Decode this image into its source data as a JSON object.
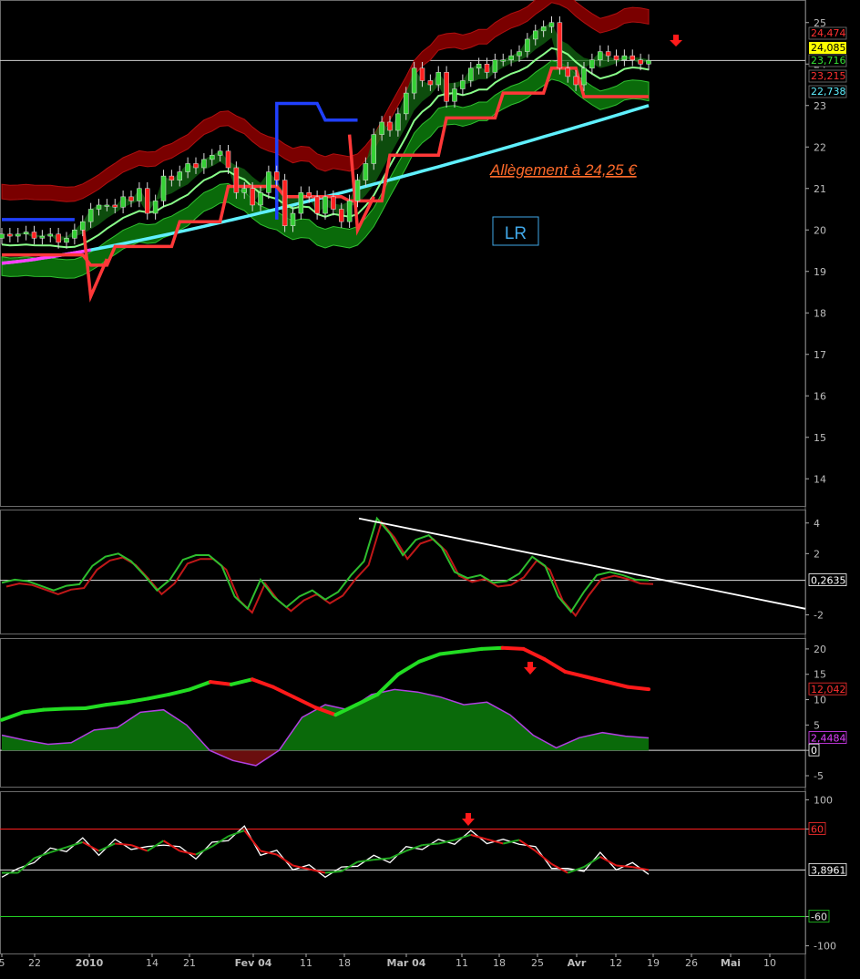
{
  "chart_data": [
    {
      "type": "candlestick",
      "panel": "price",
      "ylim": [
        13.5,
        25.5
      ],
      "y_ticks": [
        "25",
        "24",
        "23",
        "22",
        "21",
        "20",
        "19",
        "18",
        "17",
        "16",
        "15",
        "14"
      ],
      "price_labels": [
        {
          "text": "24,474",
          "color": "#ff3030"
        },
        {
          "text": "24,085",
          "color": "#000000",
          "bg": "#ffff00"
        },
        {
          "text": "23,716",
          "color": "#35e035"
        },
        {
          "text": "23,215",
          "color": "#ff3030"
        },
        {
          "text": "22,738",
          "color": "#5ff0ff"
        }
      ],
      "last_price": 24.085,
      "annotation": "Allègement à 24,25 €",
      "badge": "LR",
      "series": {
        "closes": [
          19.9,
          19.85,
          19.9,
          19.95,
          19.8,
          19.85,
          19.9,
          19.7,
          19.8,
          20.0,
          20.2,
          20.5,
          20.6,
          20.6,
          20.55,
          20.8,
          20.7,
          21.0,
          20.4,
          20.7,
          21.3,
          21.2,
          21.4,
          21.6,
          21.5,
          21.7,
          21.8,
          21.9,
          21.5,
          20.9,
          21.0,
          20.6,
          20.9,
          21.4,
          21.2,
          20.1,
          20.4,
          20.9,
          20.8,
          20.4,
          20.8,
          20.5,
          20.2,
          20.7,
          21.2,
          21.6,
          22.3,
          22.6,
          22.4,
          22.8,
          23.3,
          23.9,
          23.6,
          23.5,
          23.8,
          23.1,
          23.4,
          23.6,
          23.9,
          24.0,
          23.8,
          24.1,
          24.1,
          24.2,
          24.3,
          24.6,
          24.8,
          24.9,
          25.0,
          23.9,
          23.7,
          23.5,
          23.9,
          24.1,
          24.3,
          24.2,
          24.1,
          24.2,
          24.1,
          24.0,
          24.085
        ]
      }
    },
    {
      "type": "line",
      "panel": "oscillator-1",
      "ylim": [
        -3.1,
        4.7
      ],
      "y_ticks": [
        "4",
        "2",
        "-2"
      ],
      "last_value": "0,2635",
      "values": [
        0.1,
        0.3,
        0.2,
        -0.1,
        -0.4,
        -0.1,
        0.0,
        1.2,
        1.8,
        2.0,
        1.5,
        0.6,
        -0.4,
        0.3,
        1.6,
        1.9,
        1.9,
        1.2,
        -0.8,
        -1.6,
        0.3,
        -0.8,
        -1.5,
        -0.8,
        -0.4,
        -1.0,
        -0.5,
        0.6,
        1.5,
        4.3,
        3.3,
        1.9,
        2.9,
        3.2,
        2.4,
        0.8,
        0.4,
        0.6,
        0.1,
        0.2,
        0.7,
        1.8,
        1.2,
        -0.8,
        -1.8,
        -0.5,
        0.6,
        0.8,
        0.6,
        0.3,
        0.26
      ],
      "trendline": [
        [
          29,
          4.3
        ],
        [
          88,
          -1.4
        ]
      ]
    },
    {
      "type": "area",
      "panel": "oscillator-2",
      "ylim": [
        -6.8,
        21.6
      ],
      "y_ticks": [
        "20",
        "15",
        "10",
        "5",
        "0",
        "-5"
      ],
      "last_values": [
        "12,042",
        "2,4484",
        "0"
      ],
      "signal": [
        6.0,
        7.5,
        8.0,
        8.2,
        8.3,
        9.0,
        9.5,
        10.2,
        11.0,
        12.0,
        13.5,
        13.0,
        14.0,
        12.5,
        10.5,
        8.5,
        7.0,
        9.0,
        11.0,
        15.0,
        17.5,
        19.0,
        19.5,
        20.0,
        20.2,
        20.0,
        18.0,
        15.5,
        14.5,
        13.5,
        12.5,
        12.042
      ],
      "values": [
        3.0,
        2.0,
        1.2,
        1.5,
        4.0,
        4.5,
        7.5,
        8.0,
        5.0,
        0.0,
        -2.0,
        -3.0,
        0.0,
        6.5,
        9.0,
        8.0,
        11.0,
        12.0,
        11.5,
        10.5,
        9.0,
        9.5,
        7.0,
        3.0,
        0.5,
        2.5,
        3.5,
        2.8,
        2.4484
      ]
    },
    {
      "type": "line",
      "panel": "oscillator-3",
      "ylim": [
        -108,
        108
      ],
      "y_ticks": [
        "100",
        "60",
        "-60",
        "-100"
      ],
      "last_value": "3,8961",
      "bands": [
        "60",
        "-60"
      ],
      "values": [
        0,
        0,
        20,
        28,
        35,
        42,
        30,
        40,
        38,
        30,
        44,
        30,
        25,
        36,
        50,
        58,
        30,
        25,
        10,
        5,
        0,
        2,
        15,
        18,
        20,
        30,
        38,
        40,
        45,
        52,
        46,
        40,
        45,
        30,
        12,
        0,
        8,
        22,
        10,
        8,
        3.9
      ]
    }
  ],
  "x_axis": {
    "labels": [
      "5",
      "22",
      "2010",
      "14",
      "21",
      "Fev 04",
      "11",
      "18",
      "Mar 04",
      "11",
      "18",
      "25",
      "Avr",
      "12",
      "19",
      "26",
      "Mai",
      "10"
    ]
  }
}
